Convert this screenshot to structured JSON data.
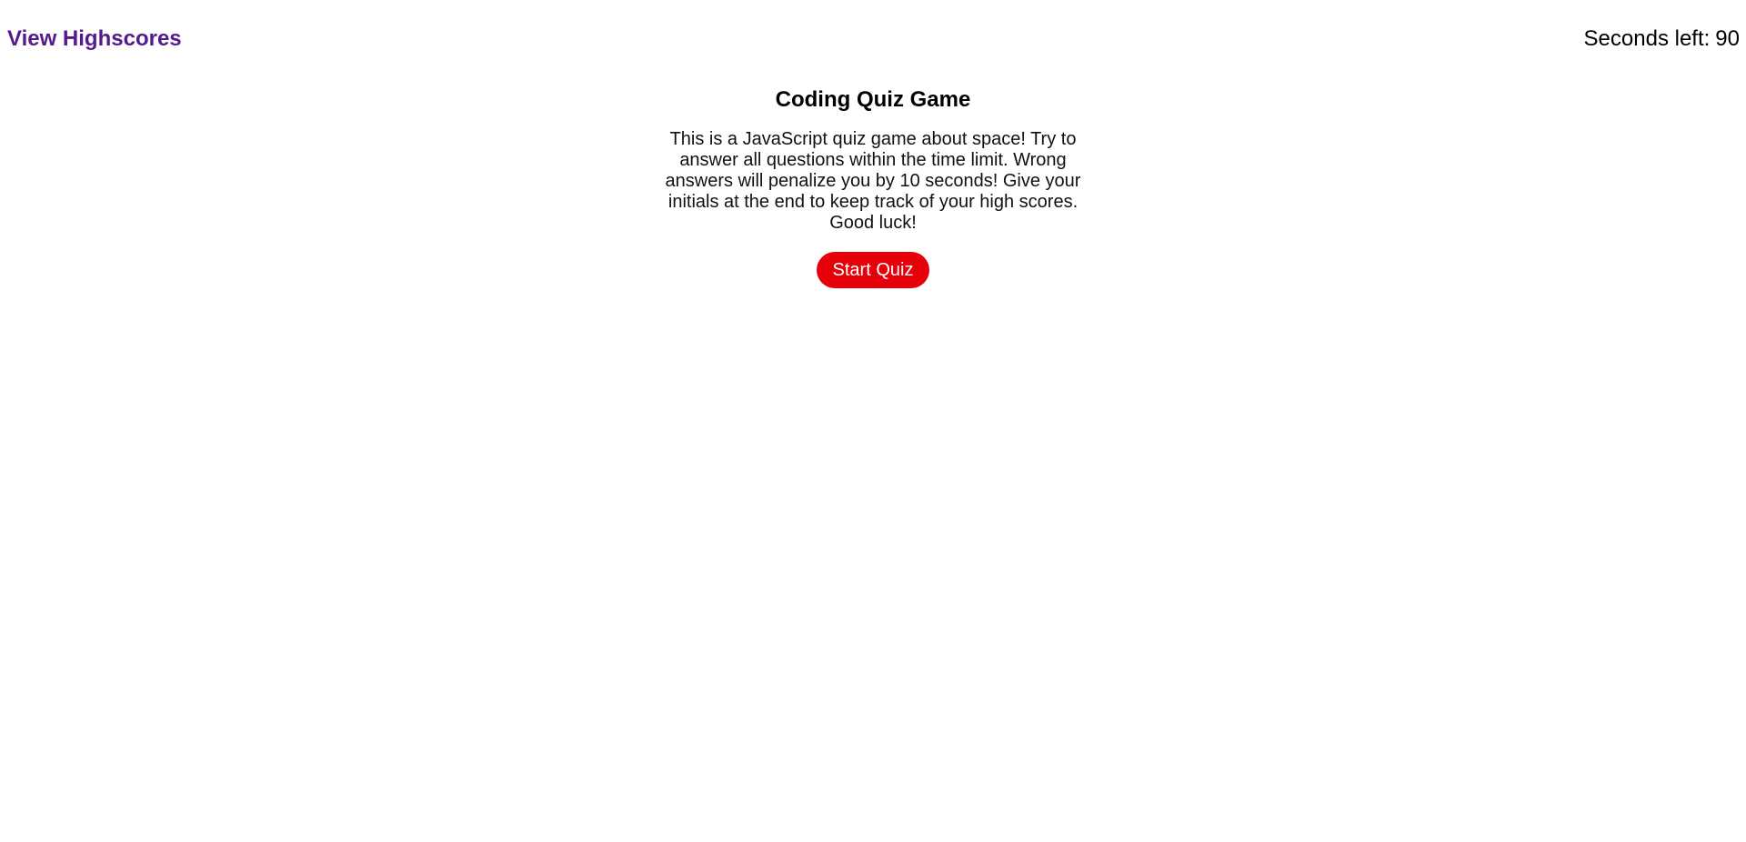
{
  "header": {
    "highscores_label": "View Highscores",
    "timer_label": "Seconds left:",
    "timer_value": "90"
  },
  "main": {
    "title": "Coding Quiz Game",
    "description": "This is a JavaScript quiz game about space! Try to answer all questions within the time limit. Wrong answers will penalize you by 10 seconds! Give your initials at the end to keep track of your high scores. Good luck!",
    "start_label": "Start Quiz"
  },
  "colors": {
    "link": "#551a8b",
    "start_button_bg": "#e5000a",
    "start_button_text": "#ffffff"
  }
}
